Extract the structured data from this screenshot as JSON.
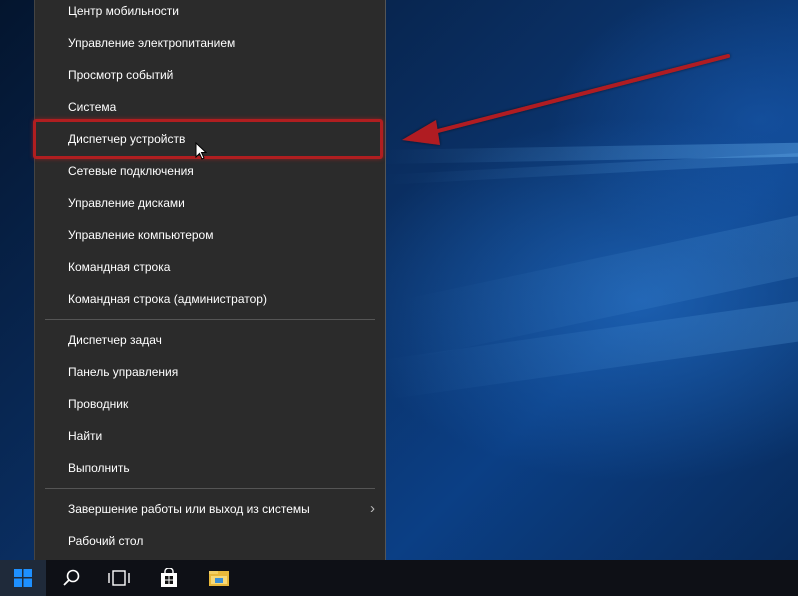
{
  "menu": {
    "items_top": [
      "Центр мобильности",
      "Управление электропитанием",
      "Просмотр событий",
      "Система",
      "Диспетчер устройств",
      "Сетевые подключения",
      "Управление дисками",
      "Управление компьютером",
      "Командная строка",
      "Командная строка (администратор)"
    ],
    "items_mid": [
      "Диспетчер задач",
      "Панель управления",
      "Проводник",
      "Найти",
      "Выполнить"
    ],
    "items_bottom": [
      "Завершение работы или выход из системы",
      "Рабочий стол"
    ],
    "highlighted": "Диспетчер устройств"
  },
  "taskbar": {
    "icons": [
      "windows-start-icon",
      "search-icon",
      "task-view-icon",
      "store-icon",
      "file-explorer-icon"
    ]
  },
  "colors": {
    "menu_bg": "#2b2b2b",
    "highlight_border": "#b01e20",
    "arrow": "#b01e20",
    "accent": "#1e90ff"
  }
}
